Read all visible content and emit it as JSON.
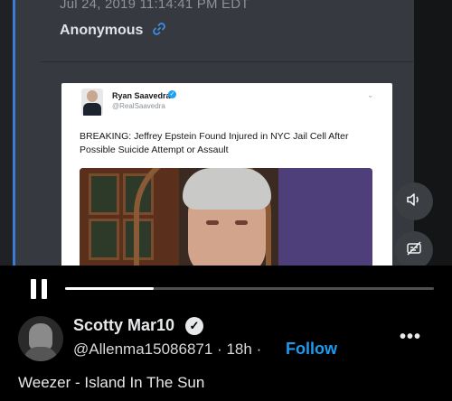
{
  "video": {
    "message": {
      "timestamp": "Jul 24, 2019 11:14:41 PM EDT",
      "author": "Anonymous"
    },
    "tweet": {
      "name": "Ryan Saavedra",
      "handle": "@RealSaavedra",
      "text": "BREAKING: Jeffrey Epstein Found Injured in NYC Jail Cell After Possible Suicide Attempt or Assault"
    },
    "progress": 0.24
  },
  "post": {
    "display_name": "Scotty Mar10",
    "handle": "@Allenma15086871",
    "separator": "·",
    "age": "18h",
    "follow_label": "Follow",
    "more_label": "•••",
    "caption": "Weezer - Island In The Sun"
  },
  "icons": {
    "link": "link-icon",
    "volume": "volume-icon",
    "captions": "captions-off-icon",
    "pause": "pause-icon",
    "verified": "verified-badge-icon",
    "more": "more-icon"
  },
  "colors": {
    "accent": "#3a7bd5",
    "follow": "#1d9bf0",
    "background": "#000000"
  }
}
